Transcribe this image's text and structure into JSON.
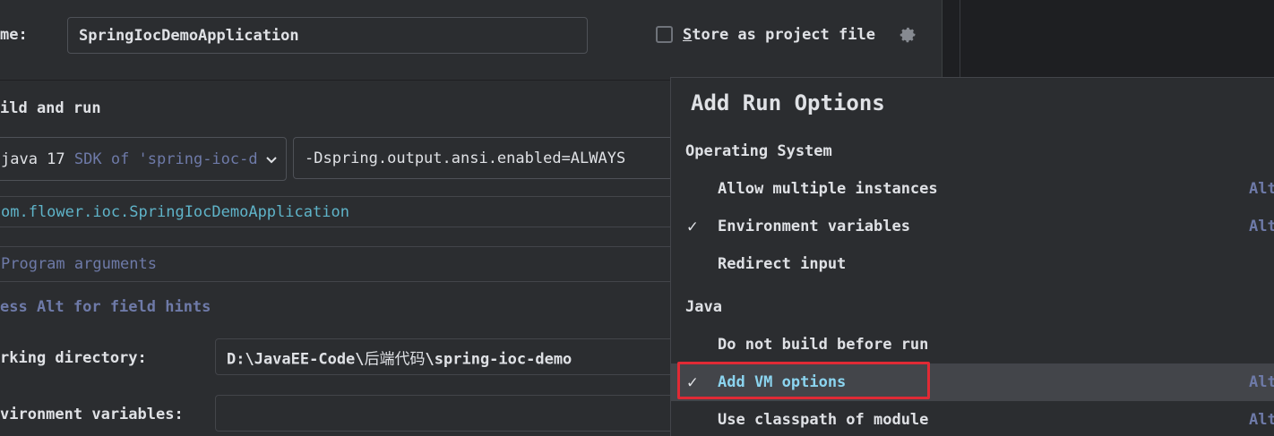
{
  "name_row": {
    "label": "me:",
    "value": "SpringIocDemoApplication",
    "store_checkbox_checked": false,
    "store_label_first": "S",
    "store_label_rest": "tore as project file",
    "settings_icon": "gear-icon"
  },
  "build_run": {
    "heading": "ild and run",
    "jdk_name": "java 17",
    "jdk_hint": "SDK of 'spring-ioc-d",
    "vm_options": "-Dspring.output.ansi.enabled=ALWAYS",
    "main_class": "om.flower.ioc.SpringIocDemoApplication",
    "program_args_placeholder": "Program arguments",
    "hint": "ess Alt for field hints"
  },
  "working_dir": {
    "label": "rking directory:",
    "value_prefix": "D:\\JavaEE-Code\\",
    "value_cjk": "后端代码",
    "value_suffix": "\\spring-ioc-demo"
  },
  "env_vars": {
    "label": "vironment variables:",
    "value": ""
  },
  "popup": {
    "title": "Add Run Options",
    "sections": [
      {
        "name": "Operating System",
        "items": [
          {
            "label": "Allow multiple instances",
            "checked": false,
            "shortcut": "Alt"
          },
          {
            "label": "Environment variables",
            "checked": true,
            "shortcut": "Alt"
          },
          {
            "label": "Redirect input",
            "checked": false,
            "shortcut": ""
          }
        ]
      },
      {
        "name": "Java",
        "items": [
          {
            "label": "Do not build before run",
            "checked": false,
            "shortcut": ""
          },
          {
            "label": "Add VM options",
            "checked": true,
            "shortcut": "Alt",
            "selected": true
          },
          {
            "label": "Use classpath of module",
            "checked": false,
            "shortcut": "Alt"
          }
        ]
      }
    ],
    "check_glyph": "✓"
  },
  "colors": {
    "background": "#2b2d30",
    "text": "#dfe1e5",
    "hint_text": "#6e7aa8",
    "link_text": "#5fb4c9",
    "highlight": "#e02a35",
    "selected_row": "#43454a"
  }
}
